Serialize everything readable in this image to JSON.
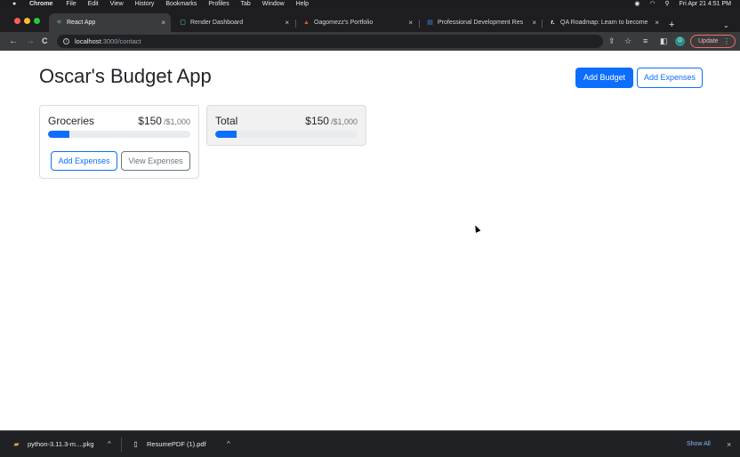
{
  "menubar": {
    "apple": "",
    "app_name": "Chrome",
    "menus": [
      "File",
      "Edit",
      "View",
      "History",
      "Bookmarks",
      "Profiles",
      "Tab",
      "Window",
      "Help"
    ],
    "clock": "Fri Apr 21  4:51 PM"
  },
  "tabs": [
    {
      "label": "React App",
      "icon": "⚛",
      "active": true
    },
    {
      "label": "Render Dashboard",
      "icon": "▢",
      "active": false
    },
    {
      "label": "Oagomezz's Portfolio",
      "icon": "▲",
      "active": false
    },
    {
      "label": "Professional Development Res",
      "icon": "▤",
      "active": false
    },
    {
      "label": "QA Roadmap: Learn to become",
      "icon": "r.",
      "active": false
    }
  ],
  "tab_close_glyph": "×",
  "new_tab_glyph": "+",
  "tab_menu_glyph": "⌄",
  "toolbar": {
    "back_glyph": "←",
    "forward_glyph": "→",
    "reload_glyph": "C",
    "url_host": "localhost",
    "url_path": ":3000/contact",
    "update_label": "Update",
    "profile_initial": "O",
    "kebab_glyph": "⋮"
  },
  "app": {
    "title": "Oscar's Budget App",
    "add_budget_label": "Add Budget",
    "add_expenses_label": "Add Expenses"
  },
  "budgets": [
    {
      "name": "Groceries",
      "amount": "$150",
      "max": "/$1,000",
      "progress_fraction": 0.15,
      "add_expenses_label": "Add Expenses",
      "view_expenses_label": "View Expenses"
    }
  ],
  "total": {
    "name": "Total",
    "amount": "$150",
    "max": "/$1,000",
    "progress_fraction": 0.15
  },
  "downloads": [
    {
      "name": "python-3.11.3-m....pkg"
    },
    {
      "name": "ResumePDF (1).pdf"
    }
  ],
  "downloads_chevron": "^",
  "show_all_label": "Show All",
  "shelf_close_glyph": "×",
  "colors": {
    "primary": "#0d6efd",
    "secondary": "#6c757d",
    "progress_track": "#e9ecef",
    "total_card_bg": "#f1f1f1"
  }
}
